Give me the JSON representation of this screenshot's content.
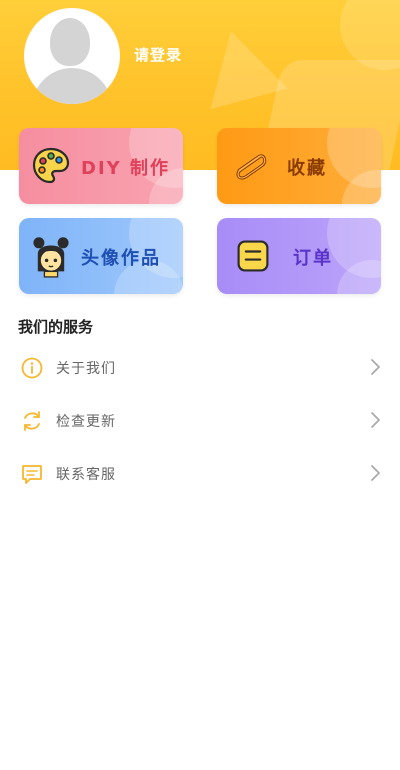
{
  "header": {
    "login_text": "请登录",
    "bg_color": "#ffc22a"
  },
  "cards": [
    {
      "name": "diy",
      "label": "DIY 制作",
      "icon": "palette-icon",
      "text_color": "#e0415a"
    },
    {
      "name": "favorites",
      "label": "收藏",
      "icon": "paperclip-icon",
      "text_color": "#8a3b00"
    },
    {
      "name": "works",
      "label": "头像作品",
      "icon": "girl-avatar-icon",
      "text_color": "#1e4fb5"
    },
    {
      "name": "orders",
      "label": "订单",
      "icon": "note-icon",
      "text_color": "#5a33c9"
    }
  ],
  "services": {
    "title": "我们的服务",
    "items": [
      {
        "label": "关于我们",
        "icon": "info-icon"
      },
      {
        "label": "检查更新",
        "icon": "refresh-icon"
      },
      {
        "label": "联系客服",
        "icon": "message-icon"
      }
    ]
  },
  "accent_color": "#f5b82e"
}
